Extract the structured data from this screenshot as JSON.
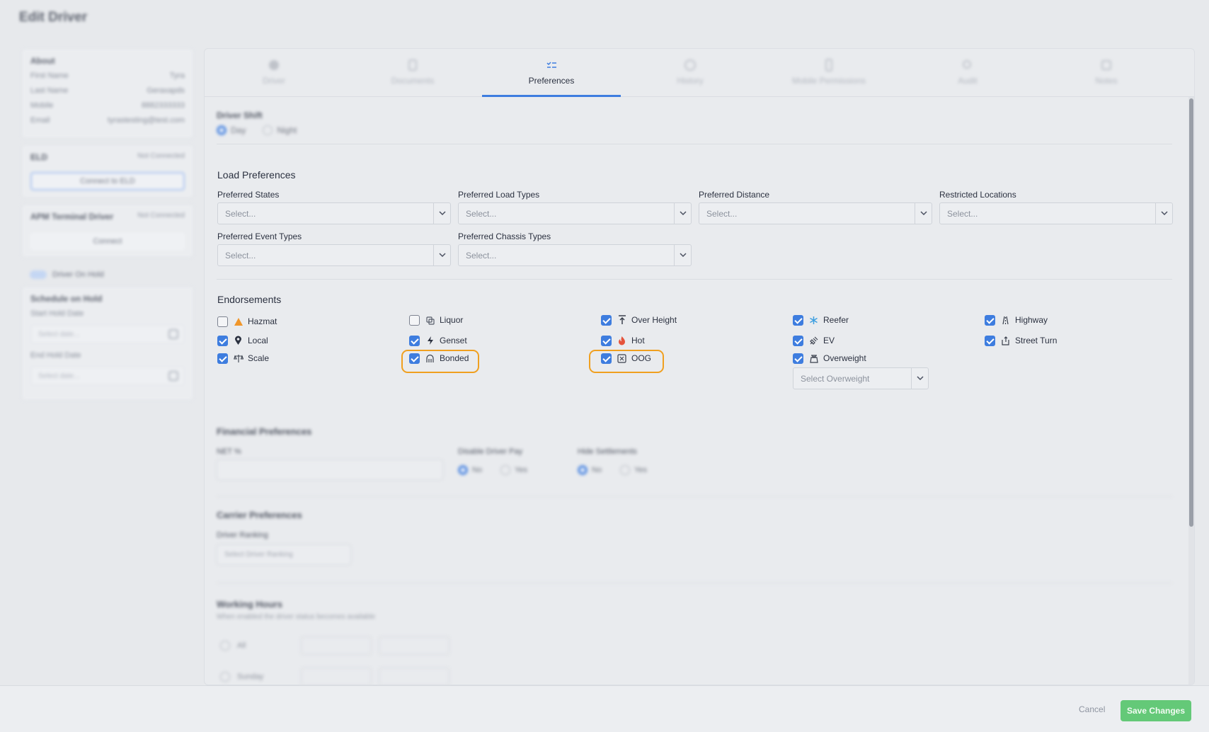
{
  "page": {
    "title": "Edit Driver"
  },
  "sidebar": {
    "about": {
      "title": "About",
      "rows": [
        {
          "label": "First Name",
          "value": "Tyra"
        },
        {
          "label": "Last Name",
          "value": "Geraxapds"
        },
        {
          "label": "Mobile",
          "value": "8882333333"
        },
        {
          "label": "Email",
          "value": "tyrastesting@test.com"
        }
      ]
    },
    "eld": {
      "title": "ELD",
      "status": "Not Connected",
      "button": "Connect to ELD"
    },
    "terminal": {
      "title": "APM Terminal Driver",
      "status": "Not Connected",
      "button": "Connect"
    },
    "on_hold": {
      "label": "Driver On Hold"
    },
    "schedule": {
      "title": "Schedule on Hold",
      "start_label": "Start Hold Date",
      "start_placeholder": "Select date...",
      "end_label": "End Hold Date",
      "end_placeholder": "Select date..."
    }
  },
  "tabs": [
    {
      "label": "Driver",
      "icon": "user-icon"
    },
    {
      "label": "Documents",
      "icon": "document-icon"
    },
    {
      "label": "Preferences",
      "icon": "preferences-icon",
      "active": true
    },
    {
      "label": "History",
      "icon": "history-icon"
    },
    {
      "label": "Mobile Permissions",
      "icon": "mobile-icon"
    },
    {
      "label": "Audit",
      "icon": "audit-icon"
    },
    {
      "label": "Notes",
      "icon": "notes-icon"
    }
  ],
  "driver_shift": {
    "title": "Driver Shift",
    "options": [
      "Day",
      "Night"
    ],
    "selected": "Day"
  },
  "load_preferences": {
    "title": "Load Preferences",
    "fields": [
      {
        "label": "Preferred States",
        "placeholder": "Select..."
      },
      {
        "label": "Preferred Load Types",
        "placeholder": "Select..."
      },
      {
        "label": "Preferred Distance",
        "placeholder": "Select..."
      },
      {
        "label": "Restricted Locations",
        "placeholder": "Select..."
      },
      {
        "label": "Preferred Event Types",
        "placeholder": "Select..."
      },
      {
        "label": "Preferred Chassis Types",
        "placeholder": "Select..."
      }
    ]
  },
  "endorsements": {
    "title": "Endorsements",
    "items": [
      {
        "label": "Hazmat",
        "checked": false,
        "icon": "hazmat-icon",
        "highlighted": false
      },
      {
        "label": "Liquor",
        "checked": false,
        "icon": "liquor-icon",
        "highlighted": false
      },
      {
        "label": "Over Height",
        "checked": true,
        "icon": "over-height-icon",
        "highlighted": false
      },
      {
        "label": "Reefer",
        "checked": true,
        "icon": "snowflake-icon",
        "highlighted": false
      },
      {
        "label": "Highway",
        "checked": true,
        "icon": "highway-icon",
        "highlighted": false
      },
      {
        "label": "Local",
        "checked": true,
        "icon": "location-pin-icon",
        "highlighted": false
      },
      {
        "label": "Genset",
        "checked": true,
        "icon": "lightning-icon",
        "highlighted": false
      },
      {
        "label": "Hot",
        "checked": true,
        "icon": "flame-icon",
        "highlighted": false
      },
      {
        "label": "EV",
        "checked": true,
        "icon": "ev-plug-icon",
        "highlighted": false
      },
      {
        "label": "Street Turn",
        "checked": true,
        "icon": "street-turn-icon",
        "highlighted": false
      },
      {
        "label": "Scale",
        "checked": true,
        "icon": "scale-icon",
        "highlighted": false
      },
      {
        "label": "Bonded",
        "checked": true,
        "icon": "bonded-icon",
        "highlighted": true
      },
      {
        "label": "OOG",
        "checked": true,
        "icon": "oog-icon",
        "highlighted": true
      },
      {
        "label": "Overweight",
        "checked": true,
        "icon": "weight-icon",
        "highlighted": false
      }
    ],
    "overweight_select": {
      "placeholder": "Select Overweight"
    }
  },
  "financial": {
    "title": "Financial Preferences",
    "net_label": "NET %",
    "double_pay": {
      "label": "Disable Driver Pay",
      "options": [
        "No",
        "Yes"
      ],
      "selected": "No"
    },
    "hide_settlements": {
      "label": "Hide Settlements",
      "options": [
        "No",
        "Yes"
      ],
      "selected": "No"
    }
  },
  "carrier": {
    "title": "Carrier Preferences",
    "ranking_label": "Driver Ranking",
    "ranking_placeholder": "Select Driver Ranking"
  },
  "working_hours": {
    "title": "Working Hours",
    "subtitle": "When enabled the driver status becomes available",
    "days": [
      "All",
      "Sunday"
    ]
  },
  "footer": {
    "cancel": "Cancel",
    "save": "Save Changes"
  },
  "colors": {
    "accent": "#3e7ddf",
    "save": "#64c978",
    "highlight": "#f0a020"
  }
}
